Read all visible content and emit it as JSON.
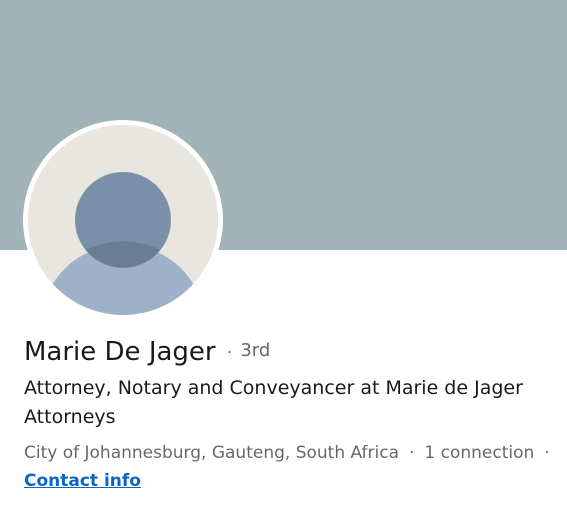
{
  "profile": {
    "name": "Marie De Jager",
    "name_separator": "·",
    "degree": "3rd",
    "headline": "Attorney, Notary and Conveyancer at Marie de Jager Attorneys",
    "location": "City of Johannesburg, Gauteng, South Africa",
    "meta_separator": "·",
    "connections": "1 connection",
    "trailing_separator": "·",
    "contact_info_label": "Contact info"
  },
  "colors": {
    "banner": "#a0b4b7",
    "avatar_background": "#e9e5df",
    "avatar_head": "#7a90a8",
    "avatar_body": "#9db1c8",
    "link": "#0a66c2"
  },
  "icons": {
    "avatar": "default-person-avatar-icon"
  }
}
